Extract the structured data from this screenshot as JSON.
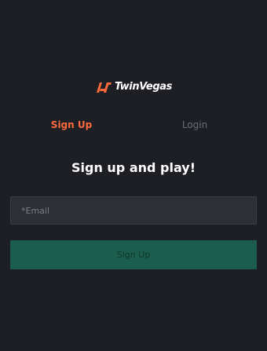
{
  "brand": {
    "name": "TwinVegas",
    "accent_color": "#ff6b3d",
    "logo_icon": "twinvegas-logo-icon"
  },
  "tabs": [
    {
      "label": "Sign Up",
      "active": true
    },
    {
      "label": "Login",
      "active": false
    }
  ],
  "form": {
    "heading": "Sign up and play!",
    "email_placeholder": "*Email",
    "email_value": "",
    "submit_label": "Sign Up",
    "submit_color": "#1b5e4d"
  }
}
